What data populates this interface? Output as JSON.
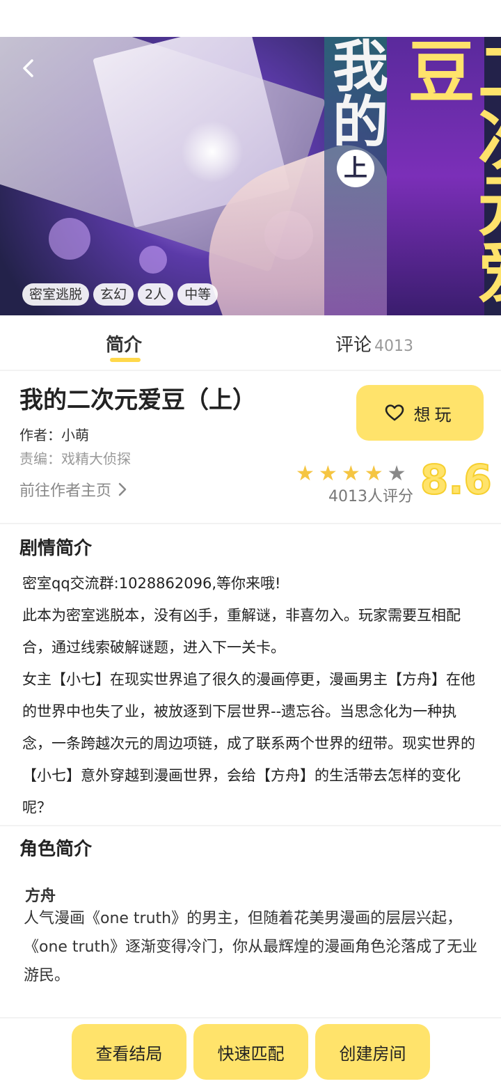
{
  "hero": {
    "title_vertical_a": "我的",
    "title_vertical_sub": "上",
    "title_vertical_b": "二次元爱豆",
    "tags": [
      "密室逃脱",
      "玄幻",
      "2人",
      "中等"
    ]
  },
  "tabs": {
    "intro_label": "简介",
    "comments_label": "评论",
    "comments_count": "4013"
  },
  "info": {
    "title": "我的二次元爱豆（上）",
    "author": "作者：小萌",
    "editor": "责编：戏精大侦探",
    "author_link": "前往作者主页",
    "want_label": "想玩",
    "stars_filled": 4,
    "stars_total": 5,
    "rating_count": "4013人评分",
    "score": "8.6"
  },
  "plot": {
    "heading": "剧情简介",
    "paragraphs": [
      "密室qq交流群:1028862096,等你来哦!",
      "此本为密室逃脱本，没有凶手，重解谜，非喜勿入。玩家需要互相配合，通过线索破解谜题，进入下一关卡。",
      "女主【小七】在现实世界追了很久的漫画停更，漫画男主【方舟】在他的世界中也失了业，被放逐到下层世界--遗忘谷。当思念化为一种执念，一条跨越次元的周边项链，成了联系两个世界的纽带。现实世界的【小七】意外穿越到漫画世界，会给【方舟】的生活带去怎样的变化呢？"
    ]
  },
  "roles": {
    "heading": "角色简介",
    "name": "方舟",
    "description": "人气漫画《one truth》的男主，但随着花美男漫画的层层兴起，《one truth》逐渐变得冷门，你从最辉煌的漫画角色沦落成了无业游民。"
  },
  "bottom": {
    "view_ending": "查看结局",
    "quick_match": "快速匹配",
    "create_room": "创建房间"
  },
  "colors": {
    "accent": "#ffe36b",
    "tab_underline": "#ffd84a",
    "star": "#f5c542"
  }
}
